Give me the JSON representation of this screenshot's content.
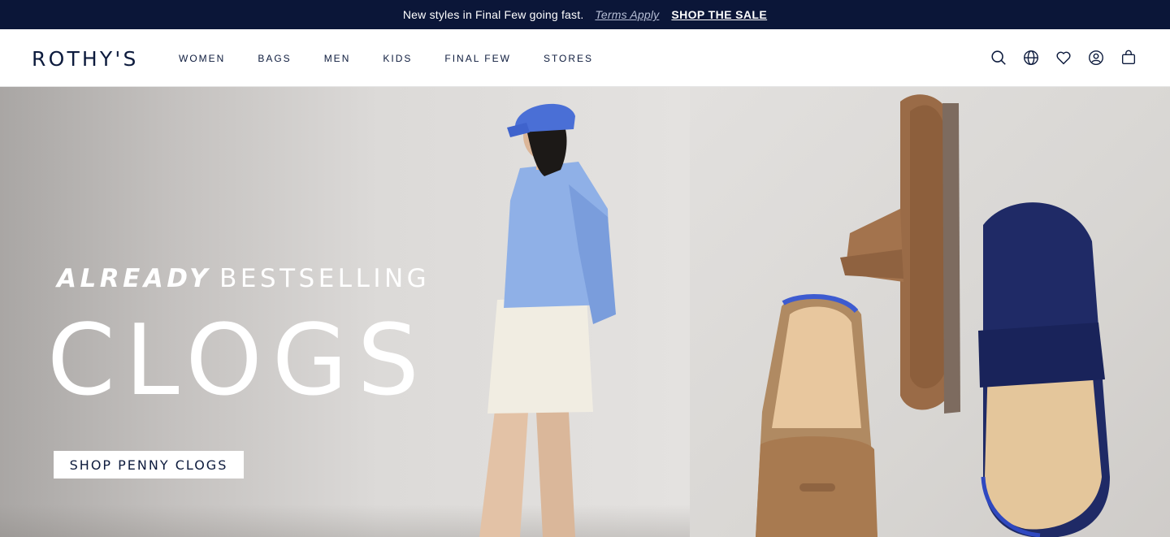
{
  "announcement": {
    "message": "New styles in Final Few going fast.",
    "terms": "Terms Apply",
    "cta": "SHOP THE SALE"
  },
  "header": {
    "logo": "ROTHY'S",
    "nav": [
      "WOMEN",
      "BAGS",
      "MEN",
      "KIDS",
      "FINAL FEW",
      "STORES"
    ],
    "icons": [
      "search-icon",
      "globe-icon",
      "heart-icon",
      "account-icon",
      "bag-icon"
    ]
  },
  "hero": {
    "tagline_italic": "ALREADY",
    "tagline_rest": "BESTSELLING",
    "headline": "CLOGS",
    "cta": "SHOP PENNY CLOGS"
  },
  "colors": {
    "navy": "#0b1638",
    "text": "#0d1b3d",
    "white": "#ffffff"
  }
}
